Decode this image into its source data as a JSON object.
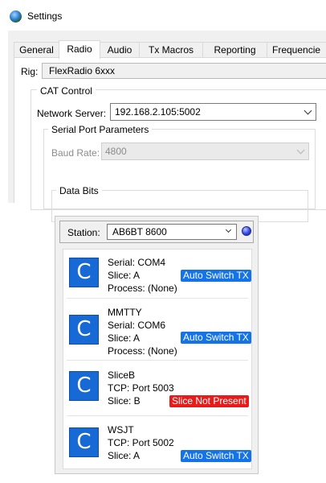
{
  "window": {
    "title": "Settings",
    "tabs": [
      "General",
      "Radio",
      "Audio",
      "Tx Macros",
      "Reporting",
      "Frequencie"
    ],
    "active_tab": "Radio"
  },
  "radio_tab": {
    "rig_label": "Rig:",
    "rig_value": "FlexRadio 6xxx",
    "cat_control": {
      "legend": "CAT Control",
      "network_server_label": "Network Server:",
      "network_server_value": "192.168.2.105:5002",
      "serial_port_parameters": {
        "legend": "Serial Port Parameters",
        "baud_rate_label": "Baud Rate:",
        "baud_rate_value": "4800",
        "data_bits_legend": "Data Bits"
      }
    }
  },
  "station_panel": {
    "station_label": "Station:",
    "station_value": "AB6BT 8600",
    "status_color": "#3246e6",
    "icon_glyph": "C",
    "entries": [
      {
        "lines": [
          "Serial: COM4",
          "Slice: A",
          "Process: (None)"
        ],
        "badge": "Auto Switch TX",
        "badge_color": "#1473e6"
      },
      {
        "lines": [
          "MMTTY",
          "Serial: COM6",
          "Slice: A",
          "Process: (None)"
        ],
        "badge": "Auto Switch TX",
        "badge_color": "#1473e6"
      },
      {
        "lines": [
          "SliceB",
          "TCP: Port 5003",
          "Slice: B"
        ],
        "badge": "Slice Not Present",
        "badge_color": "#e81a1a"
      },
      {
        "lines": [
          "WSJT",
          "TCP: Port 5002",
          "Slice: A"
        ],
        "badge": "Auto Switch TX",
        "badge_color": "#1473e6"
      }
    ]
  }
}
